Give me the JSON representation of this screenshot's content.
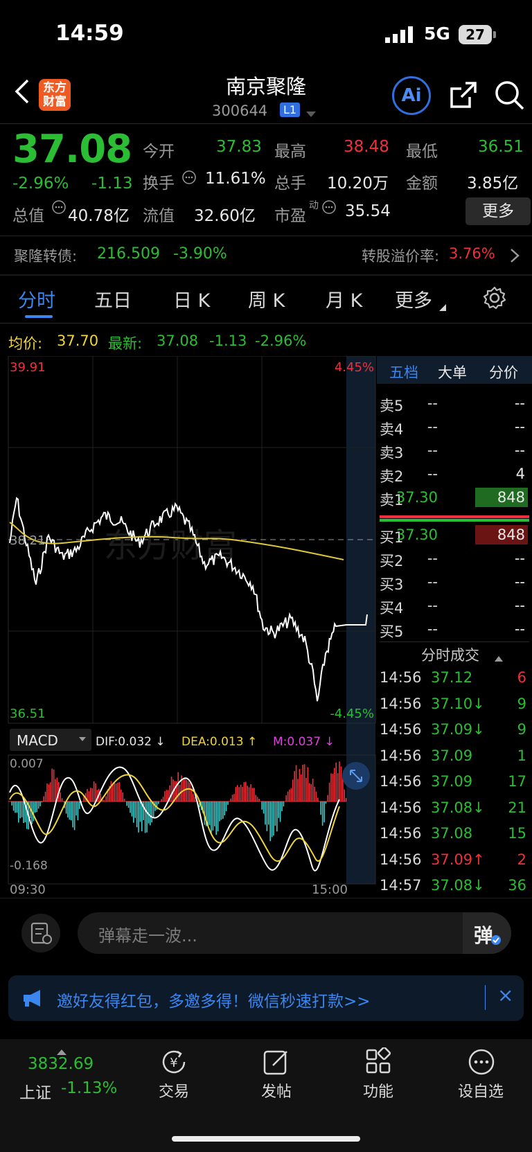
{
  "status_bar": {
    "time": "14:59",
    "network": "5G",
    "battery": "27"
  },
  "header": {
    "logo_text_1": "东方",
    "logo_text_2": "财富",
    "title": "南京聚隆",
    "code": "300644",
    "level": "L1",
    "ai_label": "Ai"
  },
  "quote": {
    "price": "37.08",
    "change_pct": "-2.96%",
    "change": "-1.13",
    "open_label": "今开",
    "open": "37.83",
    "high_label": "最高",
    "high": "38.48",
    "low_label": "最低",
    "low": "36.51",
    "turnover_label": "换手",
    "turnover": "11.61%",
    "volume_label": "总手",
    "volume": "10.20万",
    "amount_label": "金额",
    "amount": "3.85亿",
    "mktcap_label": "总值",
    "mktcap": "40.78亿",
    "float_label": "流值",
    "float": "32.60亿",
    "pe_label": "市盈",
    "pe_sup": "动",
    "pe": "35.54",
    "more_label": "更多"
  },
  "bond": {
    "name": "聚隆转债:",
    "price": "216.509",
    "change": "-3.90%",
    "premium_label": "转股溢价率:",
    "premium": "3.76%"
  },
  "tabs": [
    {
      "label": "分时"
    },
    {
      "label": "五日"
    },
    {
      "label": "日 K"
    },
    {
      "label": "周 K"
    },
    {
      "label": "月 K"
    },
    {
      "label": "更多"
    }
  ],
  "chart_info": {
    "avg_label": "均价:",
    "avg": "37.70",
    "last_label": "最新:",
    "last": "37.08",
    "chg": "-1.13",
    "pct": "-2.96%"
  },
  "chart_axis": {
    "top_price": "39.91",
    "mid_price": "38.21",
    "bottom_price": "36.51",
    "top_pct": "4.45%",
    "bottom_pct": "-4.45%",
    "watermark": "东方财富"
  },
  "macd": {
    "label": "MACD",
    "dif": "DIF:0.032 ↓",
    "dea": "DEA:0.013 ↑",
    "m": "M:0.037 ↓",
    "top": "0.007",
    "bottom": "-0.168",
    "t_start": "09:30",
    "t_end": "15:00"
  },
  "order_book_tabs": [
    "五档",
    "大单",
    "分价"
  ],
  "order_book": [
    {
      "side": "卖5",
      "price": "--",
      "vol": "--"
    },
    {
      "side": "卖4",
      "price": "--",
      "vol": "--"
    },
    {
      "side": "卖3",
      "price": "--",
      "vol": "--"
    },
    {
      "side": "卖2",
      "price": "--",
      "vol": "4"
    },
    {
      "side": "卖1",
      "price": "37.30",
      "vol": "848"
    },
    {
      "side": "买1",
      "price": "37.30",
      "vol": "848"
    },
    {
      "side": "买2",
      "price": "--",
      "vol": "--"
    },
    {
      "side": "买3",
      "price": "--",
      "vol": "--"
    },
    {
      "side": "买4",
      "price": "--",
      "vol": "--"
    },
    {
      "side": "买5",
      "price": "--",
      "vol": "--"
    }
  ],
  "trades_title": "分时成交",
  "trades": [
    {
      "time": "14:56",
      "price": "37.12",
      "vol": "6",
      "dir": ""
    },
    {
      "time": "14:56",
      "price": "37.10↓",
      "vol": "9",
      "dir": "down"
    },
    {
      "time": "14:56",
      "price": "37.09↓",
      "vol": "9",
      "dir": "down"
    },
    {
      "time": "14:56",
      "price": "37.09",
      "vol": "1",
      "dir": ""
    },
    {
      "time": "14:56",
      "price": "37.09",
      "vol": "17",
      "dir": ""
    },
    {
      "time": "14:56",
      "price": "37.08↓",
      "vol": "21",
      "dir": "down"
    },
    {
      "time": "14:56",
      "price": "37.08",
      "vol": "15",
      "dir": ""
    },
    {
      "time": "14:56",
      "price": "37.09↑",
      "vol": "2",
      "dir": "up"
    },
    {
      "time": "14:57",
      "price": "37.08↓",
      "vol": "36",
      "dir": "down"
    }
  ],
  "comment": {
    "placeholder": "弹幕走一波...",
    "send": "弹"
  },
  "notice": {
    "text": "邀好友得红包，多邀多得！微信秒速打款>>",
    "close": "×"
  },
  "bottom_tabs": {
    "index_value": "3832.69",
    "index_name": "上证",
    "index_change": "-1.13%",
    "items": [
      {
        "label": "交易"
      },
      {
        "label": "发帖"
      },
      {
        "label": "功能"
      },
      {
        "label": "设自选"
      }
    ]
  },
  "colors": {
    "up": "#f0303a",
    "down": "#2bbd33",
    "accent": "#3c86f0",
    "avg_line": "#e0c83a"
  }
}
